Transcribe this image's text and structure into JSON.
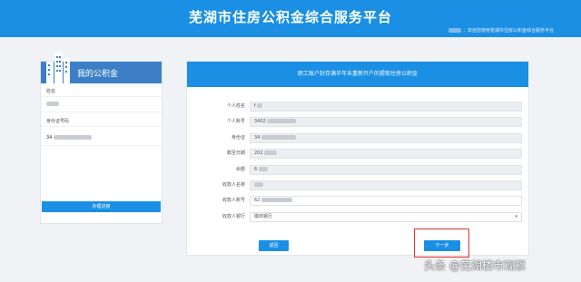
{
  "header": {
    "title": "芜湖市住房公积金综合服务平台",
    "welcome": "：欢迎您使用芜湖市住房公积金综合服务平台"
  },
  "sidebar": {
    "title": "我的公积金",
    "fields": [
      {
        "label": "姓名",
        "value": ""
      },
      {
        "label": "身份证号码",
        "value": "34"
      }
    ],
    "apply_button": "办理进度"
  },
  "form": {
    "heading": "职工账户封存满半年未重新开户的提取住房公积金",
    "rows": [
      {
        "label": "个人姓名",
        "value": "f"
      },
      {
        "label": "个人账号",
        "value": "3402"
      },
      {
        "label": "身份证",
        "value": "34"
      },
      {
        "label": "截至日期",
        "value": "202"
      },
      {
        "label": "余额",
        "value": "6"
      },
      {
        "label": "收款人名称",
        "value": ""
      },
      {
        "label": "收款人账号",
        "value": "62"
      }
    ],
    "bank_label": "收款人银行",
    "bank_value": "徽商银行",
    "back_button": "返回",
    "next_button": "下一步"
  },
  "watermark": "头条 @芜湖楼市观察"
}
